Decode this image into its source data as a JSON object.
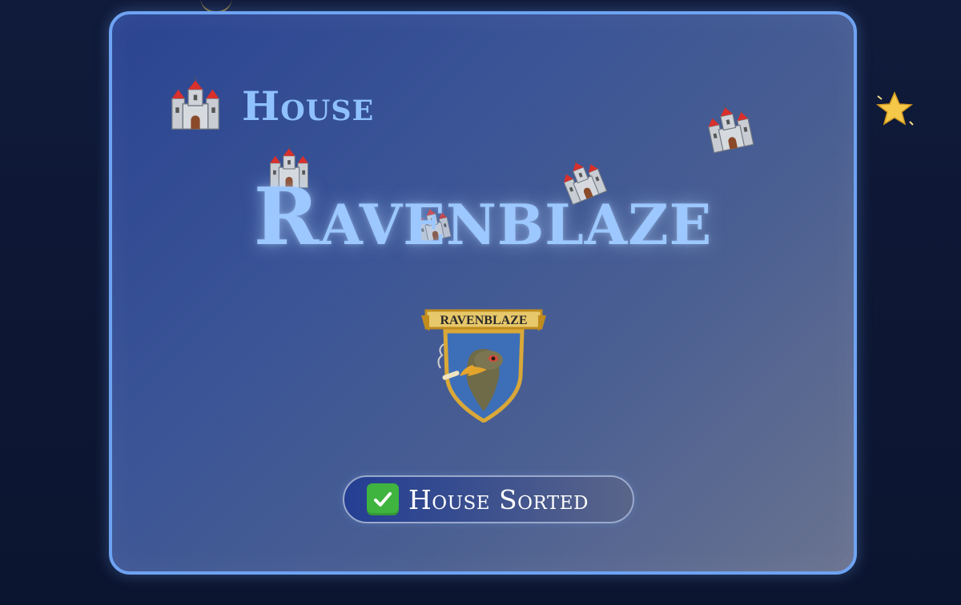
{
  "card": {
    "header_title": "House",
    "house_name": "Ravenblaze",
    "crest": {
      "banner_text": "RAVENBLAZE",
      "icon": "raven-crest-icon"
    },
    "badge": {
      "icon": "check-icon",
      "label": "House Sorted"
    }
  },
  "icons": [
    "castle-icon",
    "star-icon"
  ],
  "colors": {
    "accent": "#6ea3f2",
    "title": "#9cc8ff",
    "badge_check": "#3fb43f",
    "crest_gold": "#d9a838",
    "crest_blue": "#3d6fb8"
  }
}
